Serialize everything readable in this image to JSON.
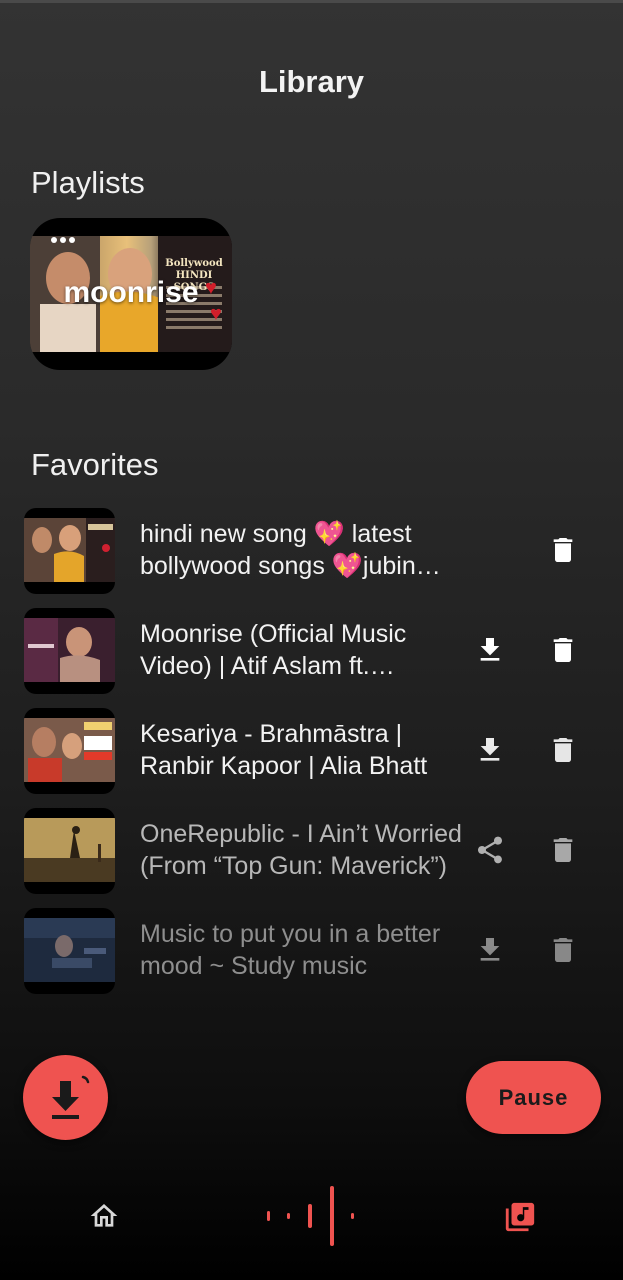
{
  "header": {
    "title": "Library"
  },
  "playlists": {
    "section_title": "Playlists",
    "items": [
      {
        "name": "moonrise",
        "art_text": "Bollywood HINDI SONGS",
        "menu_icon": "more-horizontal-icon"
      }
    ]
  },
  "favorites": {
    "section_title": "Favorites",
    "items": [
      {
        "title": "hindi new song 💖 latest bollywood songs 💖jubin nautiyal",
        "actions": [
          "delete"
        ],
        "dimmed": false
      },
      {
        "title": "Moonrise (Official Music Video) | Atif Aslam ft. Shivangi Joshi",
        "actions": [
          "download",
          "delete"
        ],
        "dimmed": false
      },
      {
        "title": "Kesariya - Brahmāstra | Ranbir Kapoor | Alia Bhatt",
        "actions": [
          "download",
          "delete"
        ],
        "dimmed": false
      },
      {
        "title": "OneRepublic - I Ain’t Worried (From “Top Gun: Maverick”)",
        "actions": [
          "share",
          "delete"
        ],
        "dimmed": true
      },
      {
        "title": "Music to put you in a better mood ~ Study music",
        "actions": [
          "download",
          "delete"
        ],
        "dimmed": true
      }
    ]
  },
  "controls": {
    "download_fab_icon": "download-icon",
    "pause_label": "Pause"
  },
  "nav": {
    "home_icon": "home-icon",
    "player_icon": "audio-wave-icon",
    "library_icon": "library-music-icon"
  },
  "colors": {
    "accent": "#ef5350",
    "text": "#f2f2f2",
    "background_top": "#333333",
    "background_bottom": "#000000"
  }
}
